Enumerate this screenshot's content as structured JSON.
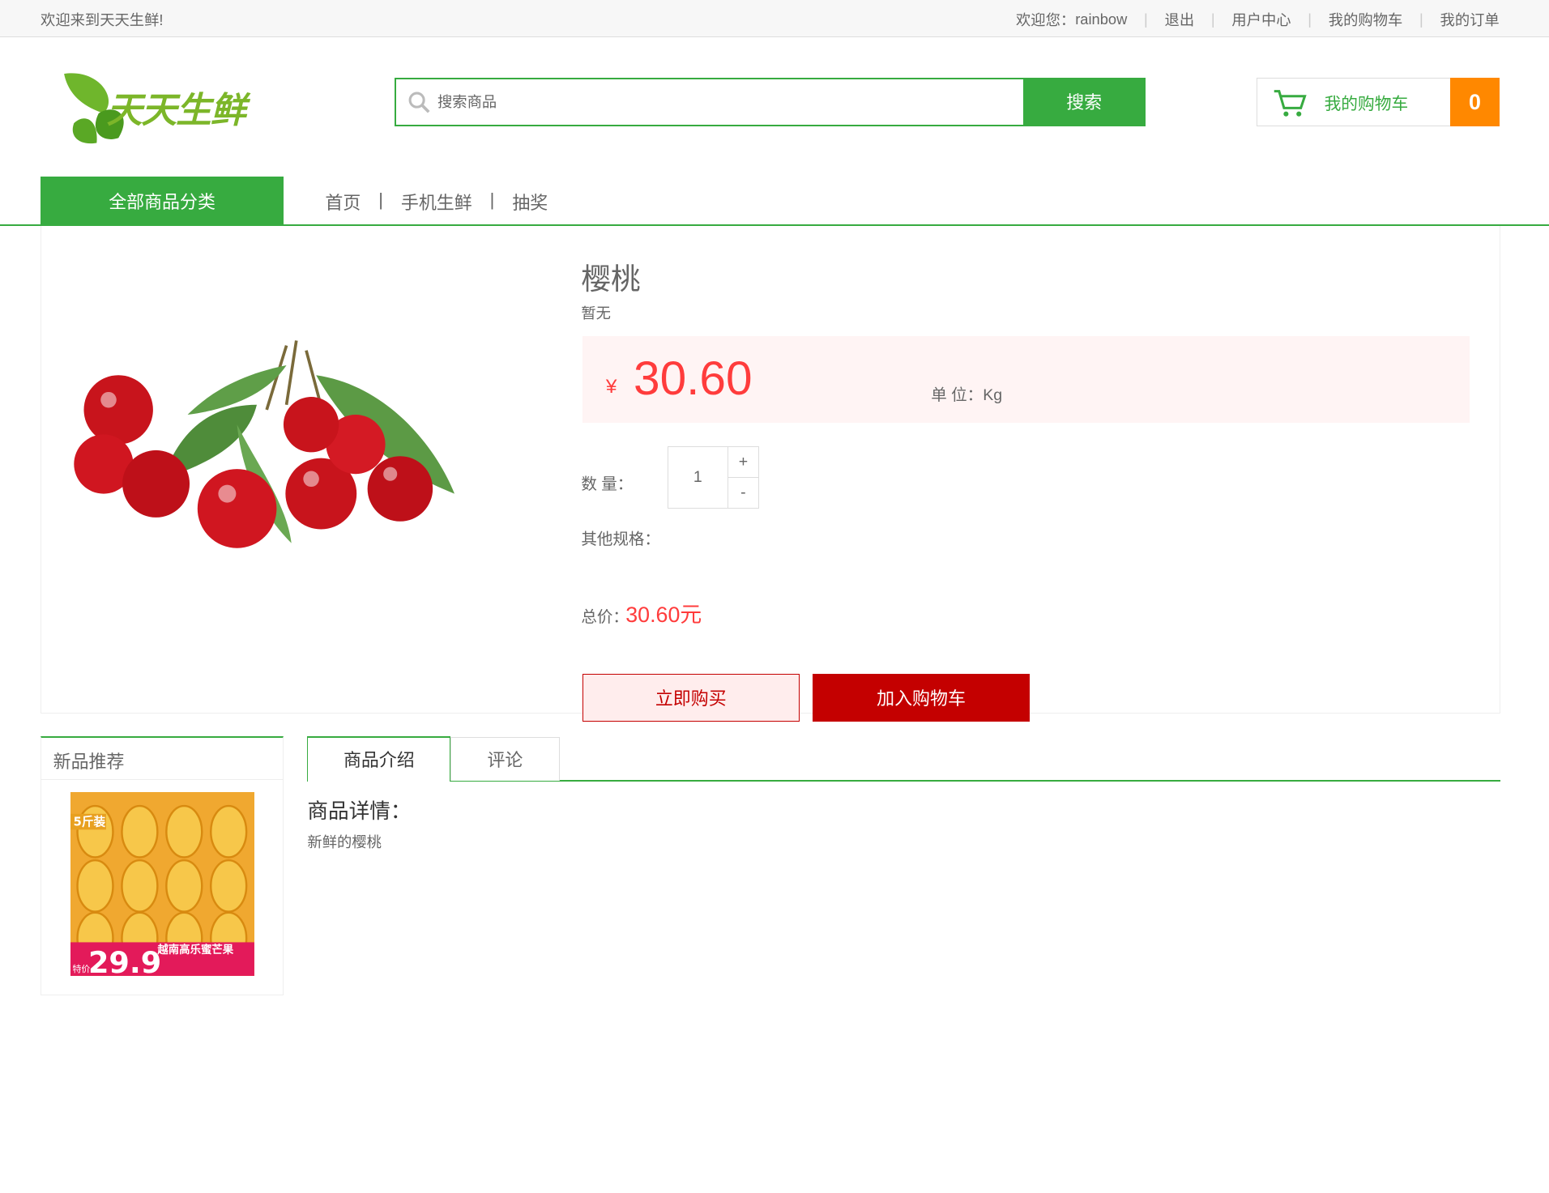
{
  "topbar": {
    "welcome": "欢迎来到天天生鲜!",
    "greeting": "欢迎您：",
    "username": "rainbow",
    "logout": "退出",
    "user_center": "用户中心",
    "my_cart": "我的购物车",
    "my_orders": "我的订单"
  },
  "header": {
    "logo_text": "天天生鲜",
    "search_placeholder": "搜索商品",
    "search_button": "搜索",
    "cart_label": "我的购物车",
    "cart_count": "0"
  },
  "nav": {
    "all_categories": "全部商品分类",
    "items": [
      "首页",
      "手机生鲜",
      "抽奖"
    ],
    "separator": "|"
  },
  "product": {
    "name": "樱桃",
    "subtitle": "暂无",
    "currency": "¥",
    "price": "30.60",
    "unit_label": "单  位：Kg",
    "quantity_label": "数  量：",
    "quantity": "1",
    "plus": "+",
    "minus": "-",
    "other_specs_label": "其他规格：",
    "total_label": "总价：",
    "total_value": "30.60元",
    "buy_now": "立即购买",
    "add_to_cart": "加入购物车"
  },
  "new_products": {
    "title": "新品推荐",
    "item_badge": "5斤装",
    "item_price": "29.9",
    "item_price_label": "特价",
    "item_banner": "越南高乐蜜芒果"
  },
  "tabs": {
    "intro": "商品介绍",
    "comments": "评论"
  },
  "detail": {
    "title": "商品详情：",
    "text": "新鲜的樱桃"
  },
  "colors": {
    "brand_green": "#37ab40",
    "price_red": "#ff3c3c",
    "button_red": "#c40000",
    "cart_orange": "#ff8800"
  }
}
